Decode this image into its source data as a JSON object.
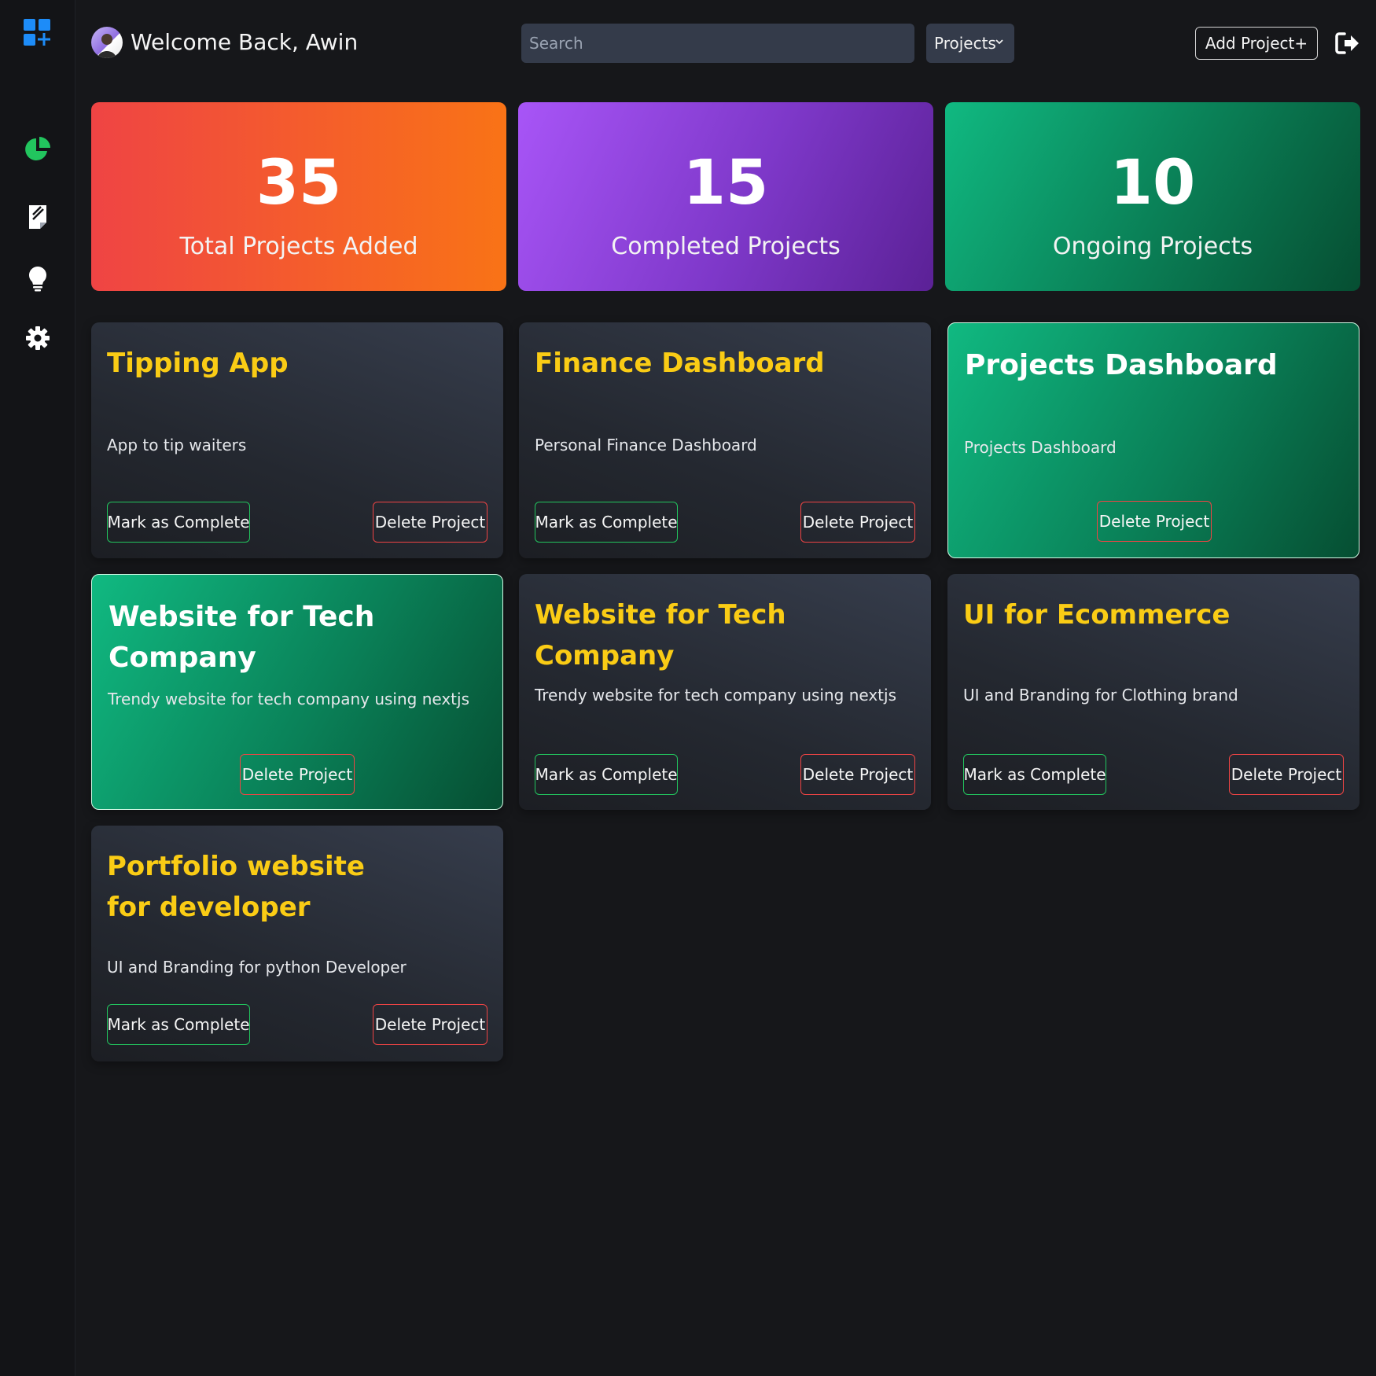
{
  "header": {
    "welcome": "Welcome Back, Awin",
    "search_placeholder": "Search",
    "filter_selected": "Projects",
    "add_project_label": "Add Project+"
  },
  "colors": {
    "accent_blue": "#1d8cf8",
    "sidebar_green": "#22c55e",
    "title_yellow": "#facc15",
    "complete_border": "#22c55e",
    "delete_border": "#ef4444"
  },
  "sidebar": {
    "icons": [
      "app-logo-icon",
      "pie-chart-icon",
      "notepad-icon",
      "lightbulb-icon",
      "gear-icon"
    ]
  },
  "stats": [
    {
      "value": "35",
      "label": "Total Projects Added"
    },
    {
      "value": "15",
      "label": "Completed Projects"
    },
    {
      "value": "10",
      "label": "Ongoing Projects"
    }
  ],
  "buttons": {
    "mark_complete": "Mark as Complete",
    "delete": "Delete Project"
  },
  "projects": [
    {
      "title": "Tipping App",
      "description": "App to tip waiters",
      "completed": false
    },
    {
      "title": "Finance Dashboard",
      "description": "Personal Finance Dashboard",
      "completed": false
    },
    {
      "title": "Projects Dashboard",
      "description": "Projects Dashboard",
      "completed": true
    },
    {
      "title": "Website for Tech Company",
      "description": "Trendy website for tech company using nextjs",
      "completed": true
    },
    {
      "title": "Website for Tech Company",
      "description": "Trendy website for tech company using nextjs",
      "completed": false
    },
    {
      "title": "UI for Ecommerce",
      "description": "UI and Branding for Clothing brand",
      "completed": false
    },
    {
      "title": "Portfolio website for developer",
      "description": "UI and Branding for python Developer",
      "completed": false
    }
  ]
}
